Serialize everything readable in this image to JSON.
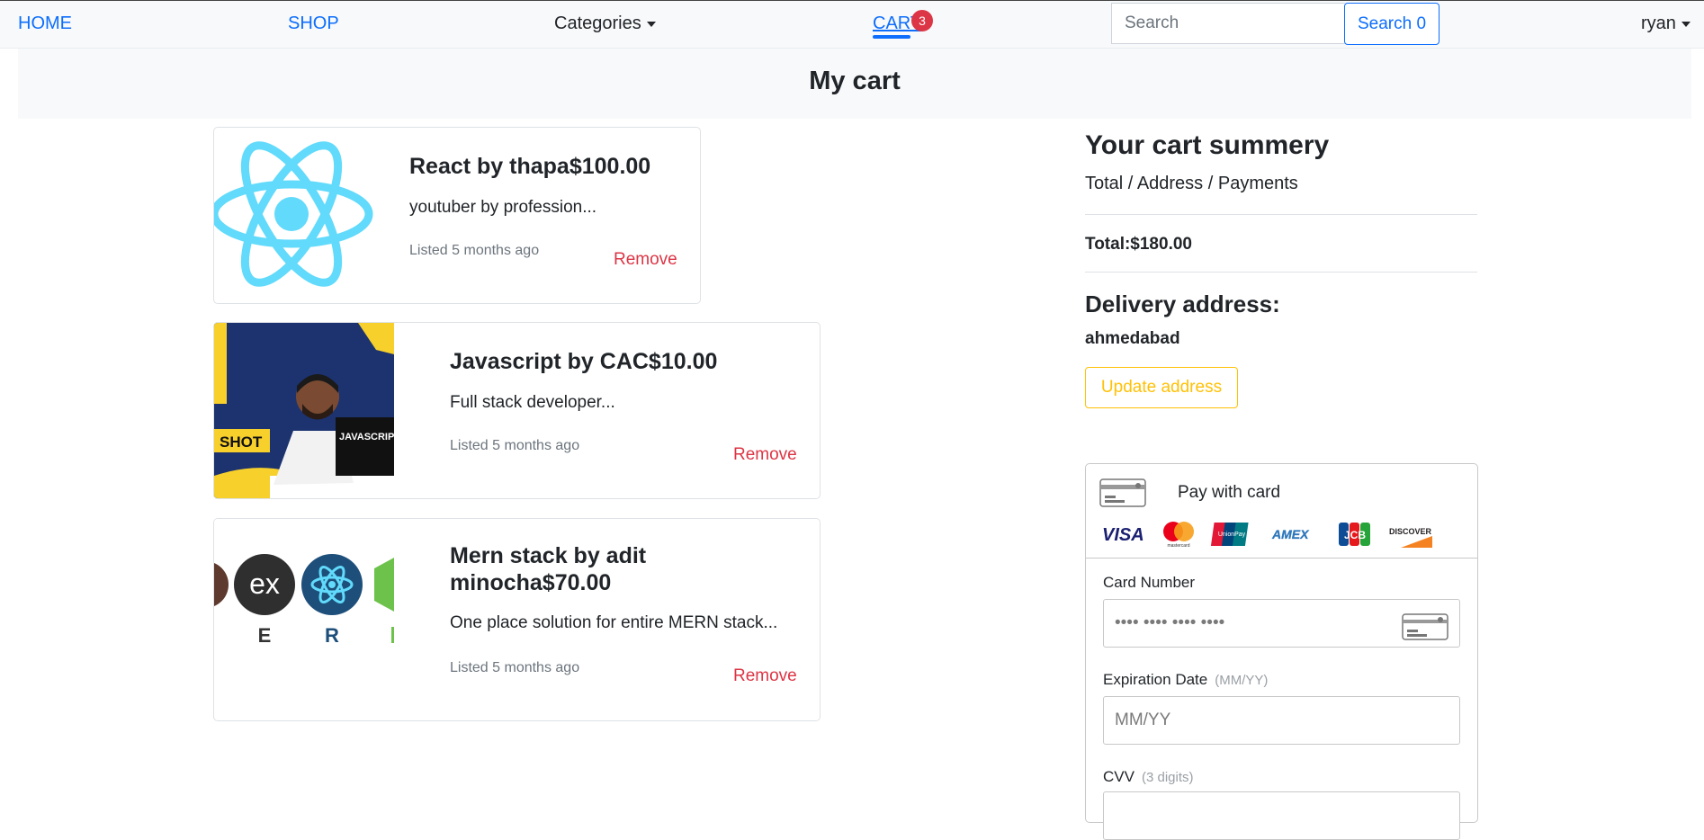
{
  "nav": {
    "home": "HOME",
    "shop": "SHOP",
    "categories": "Categories",
    "cart": "CART",
    "cart_count": "3",
    "search_placeholder": "Search",
    "search_button": "Search 0",
    "user": "ryan"
  },
  "page": {
    "title": "My cart"
  },
  "cart_items": [
    {
      "title": "React by thapa$100.00",
      "description": "youtuber by profession...",
      "listed": "Listed 5 months ago",
      "remove": "Remove",
      "image": "react-logo"
    },
    {
      "title": "Javascript by CAC$10.00",
      "description": "Full stack developer...",
      "listed": "Listed 5 months ago",
      "remove": "Remove",
      "image": "javascript-course-thumbnail",
      "image_text": [
        "SHOT",
        "JAVASCRIPT"
      ]
    },
    {
      "title_line1": "Mern stack by adit",
      "title_line2": "minocha$70.00",
      "description": "One place solution for entire MERN stack...",
      "listed": "Listed 5 months ago",
      "remove": "Remove",
      "image": "mern-stack-logos",
      "image_text": [
        "ex",
        "E",
        "R"
      ]
    }
  ],
  "summary": {
    "title": "Your cart summery",
    "subtitle": "Total / Address / Payments",
    "total": "Total:$180.00",
    "address_title": "Delivery address:",
    "address": "ahmedabad",
    "update_button": "Update address"
  },
  "payment": {
    "header": "Pay with card",
    "card_brands": [
      "VISA",
      "mastercard",
      "UnionPay",
      "AMEX",
      "JCB",
      "DISCOVER"
    ],
    "card_number_label": "Card Number",
    "card_number_placeholder": "•••• •••• •••• ••••",
    "expiry_label": "Expiration Date",
    "expiry_hint": "(MM/YY)",
    "expiry_placeholder": "MM/YY",
    "cvv_label": "CVV",
    "cvv_hint": "(3 digits)"
  },
  "colors": {
    "primary": "#0d6efd",
    "danger": "#dc3545",
    "warning": "#ffc107",
    "react": "#61dafb"
  }
}
